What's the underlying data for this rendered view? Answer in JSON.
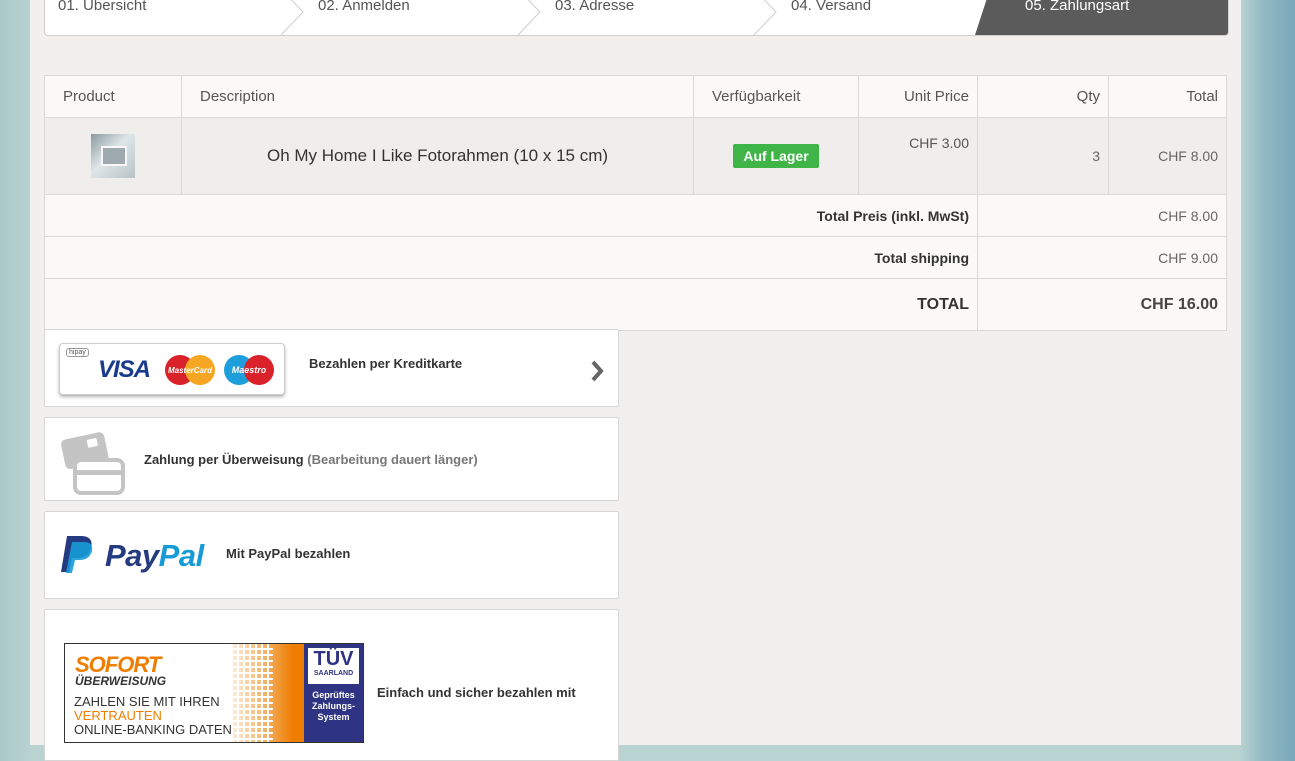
{
  "steps": [
    {
      "label": "01. Übersicht"
    },
    {
      "label": "02. Anmelden"
    },
    {
      "label": "03. Adresse"
    },
    {
      "label": "04. Versand"
    },
    {
      "label": "05. Zahlungsart"
    }
  ],
  "table": {
    "headers": {
      "product": "Product",
      "description": "Description",
      "availability": "Verfügbarkeit",
      "unit_price": "Unit Price",
      "qty": "Qty",
      "total": "Total"
    },
    "item": {
      "description": "Oh My Home I Like Fotorahmen (10 x 15 cm)",
      "availability": "Auf Lager",
      "unit_price": "CHF 3.00",
      "qty": "3",
      "total": "CHF 8.00"
    },
    "summary": {
      "total_price_label": "Total Preis (inkl. MwSt)",
      "total_price_value": "CHF 8.00",
      "shipping_label": "Total shipping",
      "shipping_value": "CHF 9.00",
      "grand_label": "TOTAL",
      "grand_value": "CHF 16.00"
    }
  },
  "payment": {
    "credit_card": {
      "label": "Bezahlen per Kreditkarte",
      "logo_hipay": "hipay",
      "logo_visa": "VISA",
      "logo_mastercard": "MasterCard",
      "logo_maestro": "Maestro"
    },
    "transfer": {
      "label": "Zahlung per Überweisung",
      "note": "(Bearbeitung dauert länger)"
    },
    "paypal": {
      "label": "Mit PayPal bezahlen",
      "logo_pay": "Pay",
      "logo_pal": "Pal"
    },
    "sofort": {
      "label": "Einfach und sicher bezahlen mit",
      "logo_line1": "SOFORT",
      "logo_line2": "ÜBERWEISUNG",
      "logo_text1": "ZAHLEN SIE MIT IHREN",
      "logo_text2": "VERTRAUTEN",
      "logo_text3": "ONLINE-BANKING DATEN.",
      "tuv_name": "TÜV",
      "tuv_region": "SAARLAND",
      "tuv_text": "Geprüftes Zahlungs-System"
    }
  },
  "colors": {
    "accent_active_step": "#5b5b5b",
    "in_stock": "#3fb548",
    "paypal_dark": "#253b80",
    "paypal_light": "#179bd7",
    "sofort_orange": "#ef7d00",
    "tuv_blue": "#2e3383"
  },
  "icons": {
    "next": "chevron-right-icon",
    "transfer": "credit-card-icon"
  }
}
